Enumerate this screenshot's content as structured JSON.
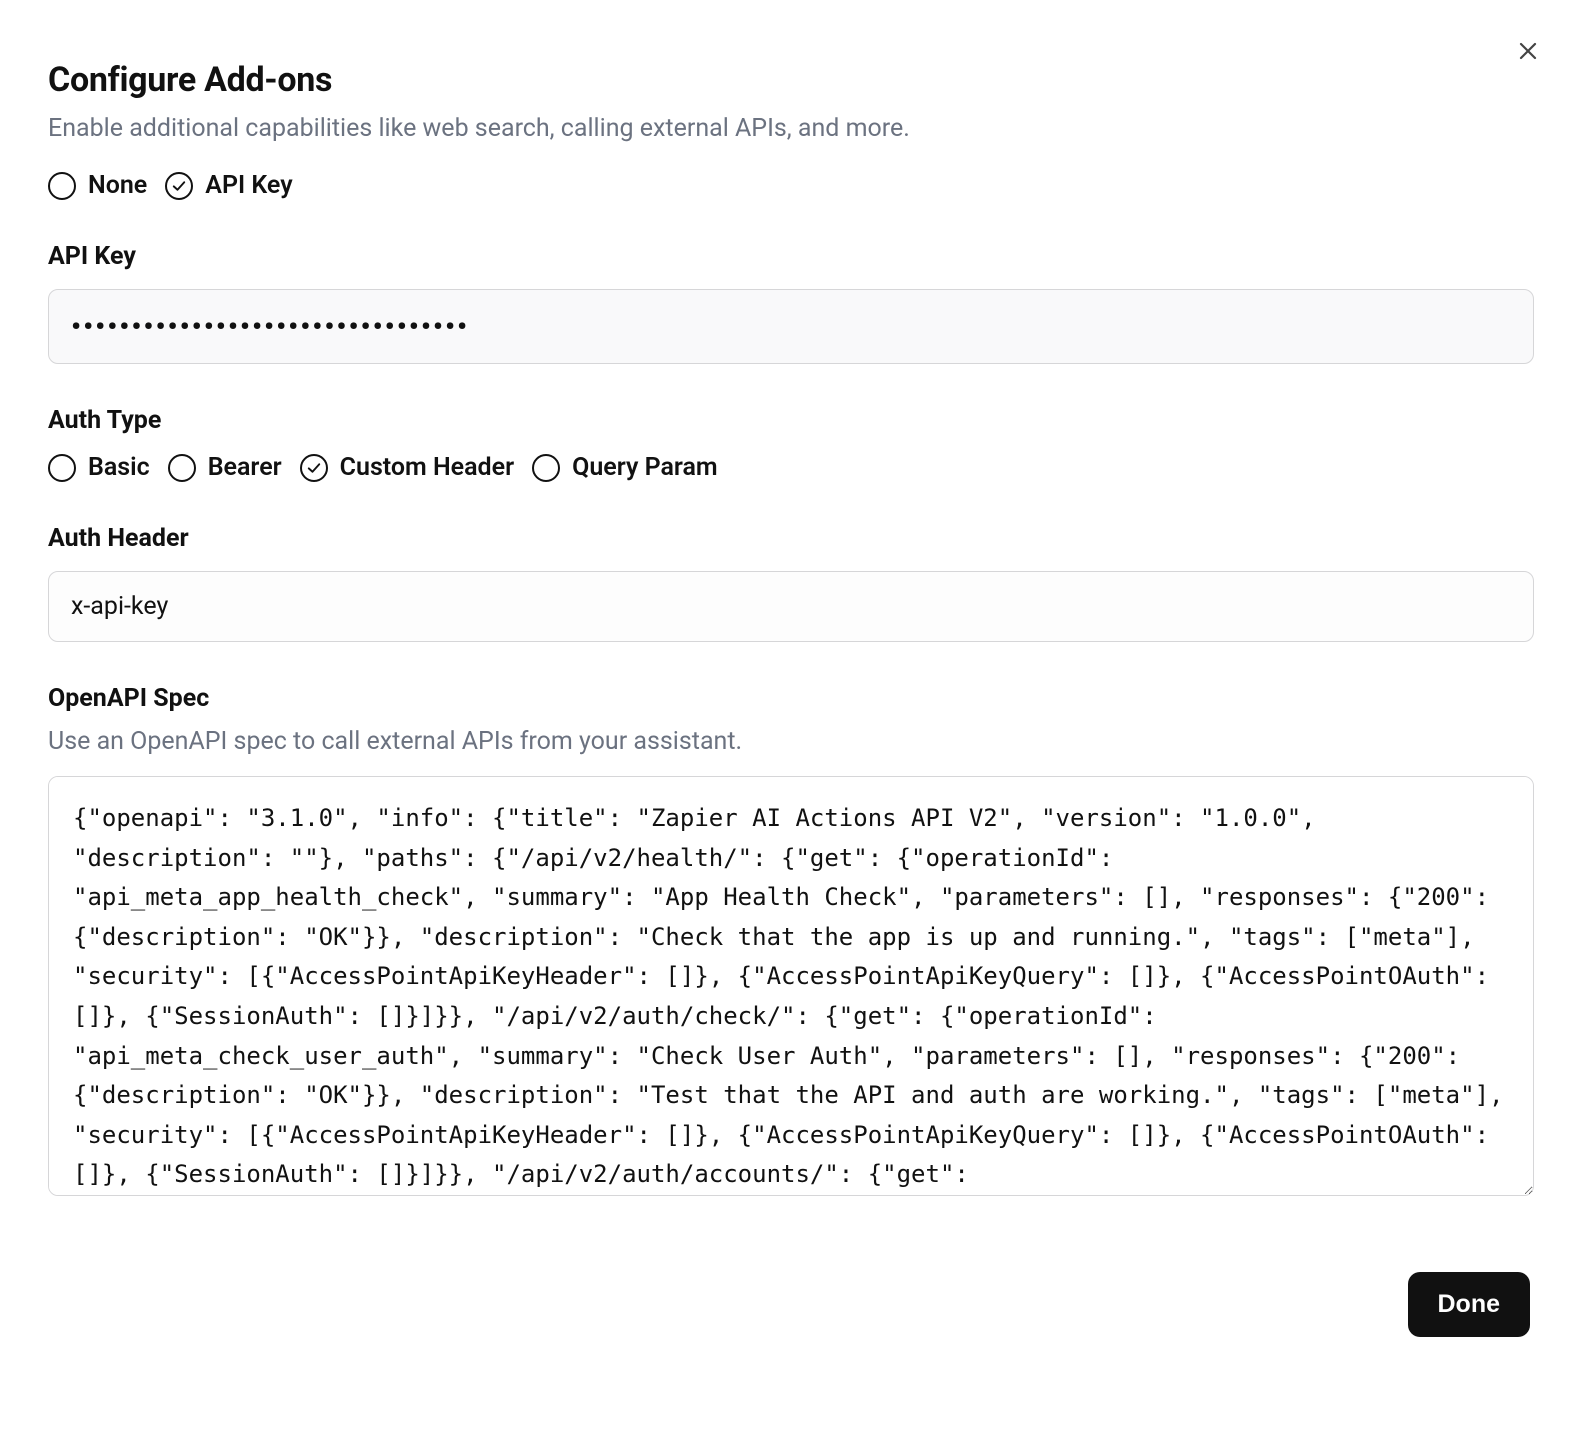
{
  "header": {
    "title": "Configure Add-ons",
    "subtitle": "Enable additional capabilities like web search, calling external APIs, and more."
  },
  "auth_mode": {
    "options": [
      {
        "label": "None",
        "selected": false
      },
      {
        "label": "API Key",
        "selected": true
      }
    ]
  },
  "api_key": {
    "label": "API Key",
    "value": "•••••••••••••••••••••••••••••••••"
  },
  "auth_type": {
    "label": "Auth Type",
    "options": [
      {
        "label": "Basic",
        "selected": false
      },
      {
        "label": "Bearer",
        "selected": false
      },
      {
        "label": "Custom Header",
        "selected": true
      },
      {
        "label": "Query Param",
        "selected": false
      }
    ]
  },
  "auth_header": {
    "label": "Auth Header",
    "value": "x-api-key"
  },
  "openapi": {
    "label": "OpenAPI Spec",
    "helper": "Use an OpenAPI spec to call external APIs from your assistant.",
    "value": "{\"openapi\": \"3.1.0\", \"info\": {\"title\": \"Zapier AI Actions API V2\", \"version\": \"1.0.0\", \"description\": \"\"}, \"paths\": {\"/api/v2/health/\": {\"get\": {\"operationId\": \"api_meta_app_health_check\", \"summary\": \"App Health Check\", \"parameters\": [], \"responses\": {\"200\": {\"description\": \"OK\"}}, \"description\": \"Check that the app is up and running.\", \"tags\": [\"meta\"], \"security\": [{\"AccessPointApiKeyHeader\": []}, {\"AccessPointApiKeyQuery\": []}, {\"AccessPointOAuth\": []}, {\"SessionAuth\": []}]}}, \"/api/v2/auth/check/\": {\"get\": {\"operationId\": \"api_meta_check_user_auth\", \"summary\": \"Check User Auth\", \"parameters\": [], \"responses\": {\"200\": {\"description\": \"OK\"}}, \"description\": \"Test that the API and auth are working.\", \"tags\": [\"meta\"], \"security\": [{\"AccessPointApiKeyHeader\": []}, {\"AccessPointApiKeyQuery\": []}, {\"AccessPointOAuth\": []}, {\"SessionAuth\": []}]}}, \"/api/v2/auth/accounts/\": {\"get\":"
  },
  "footer": {
    "done_label": "Done"
  }
}
